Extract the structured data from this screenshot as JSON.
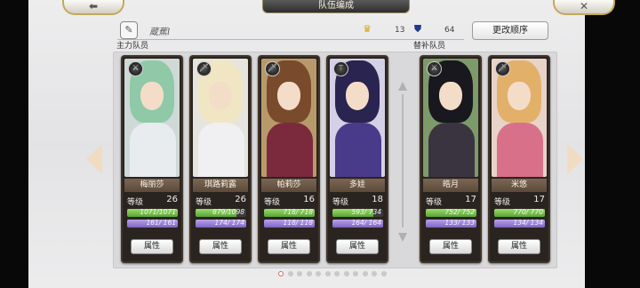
{
  "header": {
    "title": "队伍编成",
    "back_icon": "back-arrow-icon",
    "close_icon": "close-icon"
  },
  "team_bar": {
    "name": "蔵蕉l",
    "edit_icon": "pencil-icon",
    "stat_1": {
      "icon": "crown-icon",
      "value": "13"
    },
    "stat_2": {
      "icon": "shield-icon",
      "value": "64"
    },
    "change_order_label": "更改顺序"
  },
  "sections": {
    "main_label": "主力队员",
    "sub_label": "替补队员"
  },
  "cards": [
    {
      "name": "梅丽莎",
      "level_label": "等级",
      "level": "26",
      "hp_text": "1071/1071",
      "hp": 1.0,
      "mp_text": "161/ 161",
      "mp": 1.0,
      "button": "属性",
      "hair": "#8fc9a8",
      "body": "#e8ecef",
      "bg": "#cfd9d6",
      "icon": "dual-swords-icon"
    },
    {
      "name": "琪路莉露",
      "level_label": "等级",
      "level": "26",
      "hp_text": "879/1098",
      "hp": 0.8,
      "mp_text": "174/ 174",
      "mp": 1.0,
      "button": "属性",
      "hair": "#f1e6c4",
      "body": "#f0f0f2",
      "bg": "#e5e4df",
      "icon": "sword-icon"
    },
    {
      "name": "帕莉莎",
      "level_label": "等级",
      "level": "16",
      "hp_text": "718/ 718",
      "hp": 1.0,
      "mp_text": "118/ 118",
      "mp": 1.0,
      "button": "属性",
      "hair": "#7a4a2c",
      "body": "#7a2a3c",
      "bg": "#b89a6a",
      "icon": "sword-icon"
    },
    {
      "name": "多娃",
      "level_label": "等级",
      "level": "18",
      "hp_text": "593/ 734",
      "hp": 0.81,
      "mp_text": "164/ 164",
      "mp": 1.0,
      "button": "属性",
      "hair": "#2a2450",
      "body": "#4a3a8a",
      "bg": "#d4d0e6",
      "icon": "staff-icon"
    },
    {
      "name": "皓月",
      "level_label": "等级",
      "level": "17",
      "hp_text": "752/ 752",
      "hp": 1.0,
      "mp_text": "133/ 133",
      "mp": 1.0,
      "button": "属性",
      "hair": "#18181e",
      "body": "#3a3440",
      "bg": "#7d9a6a",
      "icon": "dual-swords-icon"
    },
    {
      "name": "米悠",
      "level_label": "等级",
      "level": "17",
      "hp_text": "770/ 770",
      "hp": 1.0,
      "mp_text": "134/ 134",
      "mp": 1.0,
      "button": "属性",
      "hair": "#e3b06a",
      "body": "#d8708a",
      "bg": "#e7d3c8",
      "icon": "sword-icon"
    }
  ],
  "pagination": {
    "count": 12,
    "active_index": 0
  },
  "colors": {
    "accent_gold": "#c4a85a",
    "hp_green": "#5aa336",
    "mp_purple": "#7d63c4"
  }
}
